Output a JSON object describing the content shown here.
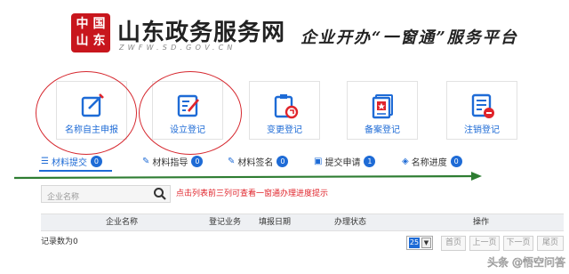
{
  "header": {
    "seal_chars": [
      "中",
      "国",
      "山",
      "东"
    ],
    "site_name": "山东政务服务网",
    "site_url": "ZWFW.SD.GOV.CN",
    "slogan": "企业开办“一窗通”服务平台"
  },
  "cards": [
    {
      "label": "名称自主申报",
      "icon": "name-report-icon"
    },
    {
      "label": "设立登记",
      "icon": "establish-registration-icon"
    },
    {
      "label": "变更登记",
      "icon": "change-registration-icon"
    },
    {
      "label": "备案登记",
      "icon": "filing-registration-icon"
    },
    {
      "label": "注销登记",
      "icon": "cancel-registration-icon"
    }
  ],
  "tabs": [
    {
      "label": "材料提交",
      "count": "0",
      "icon": "list-icon"
    },
    {
      "label": "材料指导",
      "count": "0",
      "icon": "edit-icon"
    },
    {
      "label": "材料签名",
      "count": "0",
      "icon": "sign-icon"
    },
    {
      "label": "提交申请",
      "count": "1",
      "icon": "briefcase-icon"
    },
    {
      "label": "名称进度",
      "count": "0",
      "icon": "tag-icon"
    }
  ],
  "search": {
    "placeholder": "企业名称",
    "hint": "点击列表前三列可查看一窗通办理进度提示"
  },
  "table": {
    "columns": [
      "企业名称",
      "登记业务",
      "填报日期",
      "办理状态",
      "操作"
    ]
  },
  "records": {
    "count_text": "记录数为0"
  },
  "pagination": {
    "page_size": "25",
    "first": "首页",
    "prev": "上一页",
    "next": "下一页",
    "last": "尾页"
  },
  "watermark": {
    "text": "头条 @悟空问答"
  },
  "colors": {
    "accent": "#1e6bd6",
    "highlight_red": "#d6282f",
    "arrow_green": "#2e7d32"
  }
}
